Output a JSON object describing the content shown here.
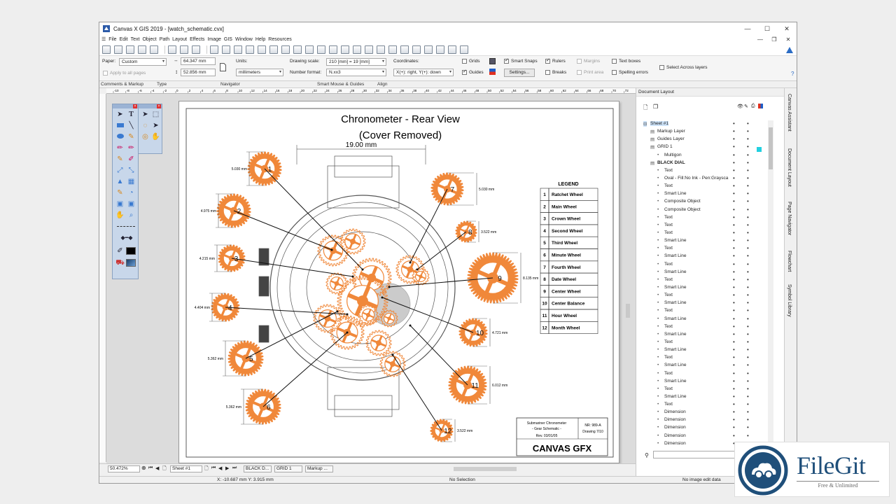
{
  "window": {
    "title": "Canvas X GIS 2019 - [watch_schematic.cvx]",
    "controls": [
      "—",
      "☐",
      "✕"
    ],
    "inner_controls": [
      "—",
      "❐",
      "✕"
    ]
  },
  "menu": [
    "File",
    "Edit",
    "Text",
    "Object",
    "Path",
    "Layout",
    "Effects",
    "Image",
    "GIS",
    "Window",
    "Help",
    "Resources"
  ],
  "props": {
    "paper_label": "Paper:",
    "paper_value": "Custom",
    "width_value": "64.347 mm",
    "height_value": "52.856 mm",
    "apply_all": "Apply to all pages",
    "units_label": "Units:",
    "units_value": "millimeters",
    "drawing_scale_label": "Drawing scale:",
    "drawing_scale_value": "210 [mm] = 19 [mm]",
    "number_format_label": "Number format:",
    "number_format_value": "N.xx3",
    "coordinates_label": "Coordinates:",
    "coordinates_value": "X(+): right, Y(+): down",
    "grids": "Grids",
    "guides": "Guides",
    "smart_snaps": "Smart Snaps",
    "settings": "Settings...",
    "rulers": "Rulers",
    "breaks": "Breaks",
    "margins": "Margins",
    "print_area": "Print area",
    "text_boxes": "Text boxes",
    "spelling_errors": "Spelling errors",
    "select_across": "Select Across layers"
  },
  "sections": [
    "Comments & Markup",
    "Type",
    "Navigator",
    "Smart Mouse & Guides",
    "Align"
  ],
  "ruler_ticks": [
    "-10",
    "-8",
    "-6",
    "-4",
    "-2",
    "0",
    "2",
    "4",
    "6",
    "8",
    "10",
    "12",
    "14",
    "16",
    "18",
    "20",
    "22",
    "24",
    "26",
    "28",
    "30",
    "32",
    "34",
    "36",
    "38",
    "40",
    "42",
    "44",
    "46",
    "48",
    "50",
    "52",
    "54",
    "56",
    "58",
    "60",
    "62",
    "64",
    "66",
    "68",
    "70",
    "72",
    "74"
  ],
  "drawing": {
    "title": "Chronometer - Rear View",
    "subtitle": "(Cover Removed)",
    "top_dim": "19.00 mm",
    "legend_title": "LEGEND",
    "legend": [
      {
        "n": "1",
        "name": "Ratchet Wheel"
      },
      {
        "n": "2",
        "name": "Main Wheel"
      },
      {
        "n": "3",
        "name": "Crown Wheel"
      },
      {
        "n": "4",
        "name": "Second Wheel"
      },
      {
        "n": "5",
        "name": "Third Wheel"
      },
      {
        "n": "6",
        "name": "Minute Wheel"
      },
      {
        "n": "7",
        "name": "Fourth Wheel"
      },
      {
        "n": "8",
        "name": "Date Wheel"
      },
      {
        "n": "9",
        "name": "Center Wheel"
      },
      {
        "n": "10",
        "name": "Center Balance"
      },
      {
        "n": "11",
        "name": "Hour Wheel"
      },
      {
        "n": "12",
        "name": "Month Wheel"
      }
    ],
    "wheel_dims": [
      "5.030 mm",
      "4.975 mm",
      "4.215 mm",
      "4.404 mm",
      "5.362 mm",
      "5.362 mm",
      "5.030 mm",
      "3.522 mm",
      "8.135 mm",
      "4.721 mm",
      "6.012 mm",
      "3.522 mm"
    ],
    "title_block": {
      "line1": "Submariner Chronometer",
      "line2": "- Gear Schematic -",
      "rev": "Rev. 03/01/05",
      "nr": "NR: 989-A",
      "drawing": "Drawing 7/10",
      "brand": "CANVAS GFX"
    },
    "orange": "#f0883a"
  },
  "panel": {
    "title": "Document Layout",
    "rows": [
      {
        "label": "Sheet #1",
        "indent": 0,
        "hl": true
      },
      {
        "label": "Markup Layer",
        "indent": 1
      },
      {
        "label": "Guides Layer",
        "indent": 1
      },
      {
        "label": "GRID 1",
        "indent": 1
      },
      {
        "label": "Multigon",
        "indent": 2
      },
      {
        "label": "BLACK DIAL",
        "indent": 1
      },
      {
        "label": "Text",
        "indent": 2
      },
      {
        "label": "Oval - Fill:No Ink - Pen:Graysca",
        "indent": 2
      },
      {
        "label": "Text",
        "indent": 2
      },
      {
        "label": "Smart Line",
        "indent": 2
      },
      {
        "label": "Composite Object",
        "indent": 2
      },
      {
        "label": "Composite Object",
        "indent": 2
      },
      {
        "label": "Text",
        "indent": 2
      },
      {
        "label": "Text",
        "indent": 2
      },
      {
        "label": "Text",
        "indent": 2
      },
      {
        "label": "Smart Line",
        "indent": 2
      },
      {
        "label": "Text",
        "indent": 2
      },
      {
        "label": "Smart Line",
        "indent": 2
      },
      {
        "label": "Text",
        "indent": 2
      },
      {
        "label": "Smart Line",
        "indent": 2
      },
      {
        "label": "Text",
        "indent": 2
      },
      {
        "label": "Smart Line",
        "indent": 2
      },
      {
        "label": "Text",
        "indent": 2
      },
      {
        "label": "Smart Line",
        "indent": 2
      },
      {
        "label": "Text",
        "indent": 2
      },
      {
        "label": "Smart Line",
        "indent": 2
      },
      {
        "label": "Text",
        "indent": 2
      },
      {
        "label": "Smart Line",
        "indent": 2
      },
      {
        "label": "Text",
        "indent": 2
      },
      {
        "label": "Smart Line",
        "indent": 2
      },
      {
        "label": "Text",
        "indent": 2
      },
      {
        "label": "Smart Line",
        "indent": 2
      },
      {
        "label": "Text",
        "indent": 2
      },
      {
        "label": "Smart Line",
        "indent": 2
      },
      {
        "label": "Text",
        "indent": 2
      },
      {
        "label": "Smart Line",
        "indent": 2
      },
      {
        "label": "Text",
        "indent": 2
      },
      {
        "label": "Dimension",
        "indent": 2
      },
      {
        "label": "Dimension",
        "indent": 2
      },
      {
        "label": "Dimension",
        "indent": 2
      },
      {
        "label": "Dimension",
        "indent": 2
      },
      {
        "label": "Dimension",
        "indent": 2
      }
    ]
  },
  "vtabs": [
    "Canvas Assistant",
    "Document Layout",
    "Page Navigator",
    "Flowchart",
    "Symbol Library"
  ],
  "bottom": {
    "zoom": "50.472%",
    "sheet": "Sheet #1",
    "layer_tabs": [
      "BLACK D...",
      "GRID 1",
      "Markup ..."
    ]
  },
  "status": {
    "coords": "X: -10.687 mm Y: 3.915 mm",
    "selection": "No Selection",
    "image": "No image edit data"
  },
  "watermark": {
    "name": "FileGit",
    "tagline": "Free & Unlimited"
  }
}
